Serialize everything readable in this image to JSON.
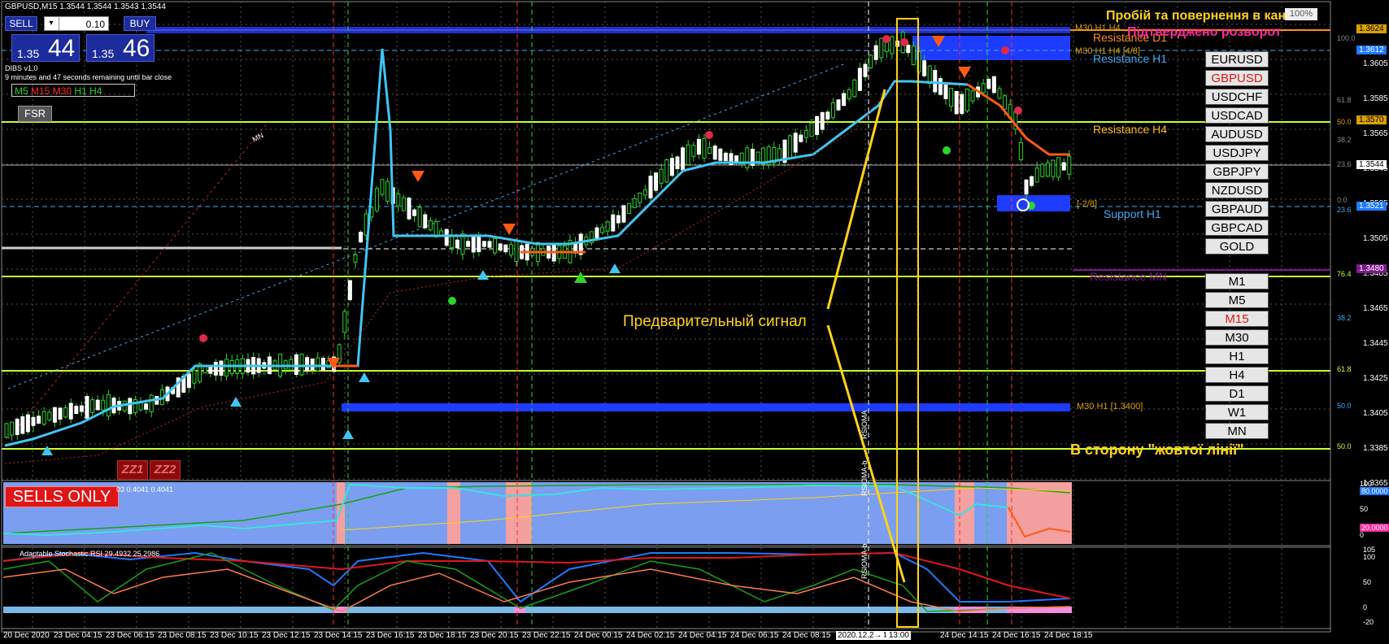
{
  "header": {
    "symbol_line": "GBPUSD,M15  1.3544 1.3544 1.3543 1.3544",
    "indicator_name": "DIBS v1.0",
    "timer_text": "9 minutes and 47 seconds remaining until bar close",
    "zoom": "100%"
  },
  "trade_panel": {
    "sell_label": "SELL",
    "buy_label": "BUY",
    "lot_value": "0.10",
    "dropdown_glyph": "▾",
    "sell_price_small": "1.35",
    "sell_price_big": "44",
    "buy_price_small": "1.35",
    "buy_price_big": "46"
  },
  "timeframe_row": {
    "m5": "M5",
    "m15": "M15",
    "m30": "M30",
    "h1": "H1",
    "h4": "H4"
  },
  "fsr_label": "FSR",
  "zz_buttons": [
    "ZZ1",
    "ZZ2"
  ],
  "sells_only_label": "SELLS ONLY",
  "annotations": {
    "top_right_title": "Пробій та повернення в кан",
    "top_right_subtitle": "Підтверджено розворот",
    "preliminary_signal": "Предварительный сигнал",
    "yellow_line_direction": "В сторону \"жовтої лінії\"",
    "mn_label": "MN"
  },
  "level_labels": {
    "resistance_d1": "Resistance D1",
    "resistance_h1": "Resistance H1",
    "resistance_h4": "Resistance H4",
    "support_h1": "Support H1",
    "resistance_mn": "Resistance MN",
    "m30_h1_top": "M30 H1 H4",
    "m30_h1_h4_48": "M30 H1 H4 [4/8]",
    "neg_28": "[-2/8]",
    "m30_h1_13400": "M30 H1 [1.3400]",
    "diag_label": "MN"
  },
  "symbols": [
    "EURUSD",
    "GBPUSD",
    "USDCHF",
    "USDCAD",
    "AUDUSD",
    "USDJPY",
    "GBPJPY",
    "NZDUSD",
    "GBPAUD",
    "GBPCAD",
    "GOLD"
  ],
  "active_symbol": "GBPUSD",
  "timeframes": [
    "M1",
    "M5",
    "M15",
    "M30",
    "H1",
    "H4",
    "D1",
    "W1",
    "MN"
  ],
  "active_timeframe": "M15",
  "price_axis": [
    "1.3605",
    "1.3585",
    "1.3565",
    "1.3545",
    "1.3525",
    "1.3505",
    "1.3485",
    "1.3465",
    "1.3445",
    "1.3425",
    "1.3405",
    "1.3385",
    "1.3365"
  ],
  "price_tags": [
    "1.3624",
    "1.3612",
    "1.3570",
    "1.3544",
    "1.3521",
    "1.3480"
  ],
  "fib_labels": [
    "100.0",
    "61.8",
    "50.0",
    "38.2",
    "23.6",
    "0.0",
    "23.6",
    "76.4",
    "38.2",
    "61.8",
    "50.0",
    "50.0"
  ],
  "oscillator1": {
    "label": "03 0.4041 0.4041",
    "axis": [
      "100",
      "80.0000",
      "50",
      "20.0000",
      "0"
    ]
  },
  "oscillator2": {
    "label": "Adaptable Stochastic RSI 29.4932 25.2986",
    "axis": [
      "105",
      "100",
      "50",
      "0",
      "-20"
    ]
  },
  "vertical_tags": [
    "RSIOMA",
    "RSIOMA-b",
    "RSIOMA-b"
  ],
  "time_axis": [
    "20 Dec 2020",
    "23 Dec 04:15",
    "23 Dec 06:15",
    "23 Dec 08:15",
    "23 Dec 10:15",
    "23 Dec 12:15",
    "23 Dec 14:15",
    "23 Dec 16:15",
    "23 Dec 18:15",
    "23 Dec 20:15",
    "23 Dec 22:15",
    "24 Dec 00:15",
    "24 Dec 02:15",
    "24 Dec 04:15",
    "24 Dec 06:15",
    "24 Dec 08:15",
    "2020.12.24 13:00",
    "24 Dec 14:15",
    "24 Dec 16:15",
    "24 Dec 18:15"
  ],
  "time_axis_highlight": "2020.12.2→",
  "colors": {
    "sell_red": "#e01616",
    "trend_cyan": "#3fc6f2",
    "bear_orange": "#ff5a14",
    "yellow_annotation": "#ffd21a",
    "candle_green": "#2bd42b",
    "level_green_yellow": "#c8ff2e"
  }
}
